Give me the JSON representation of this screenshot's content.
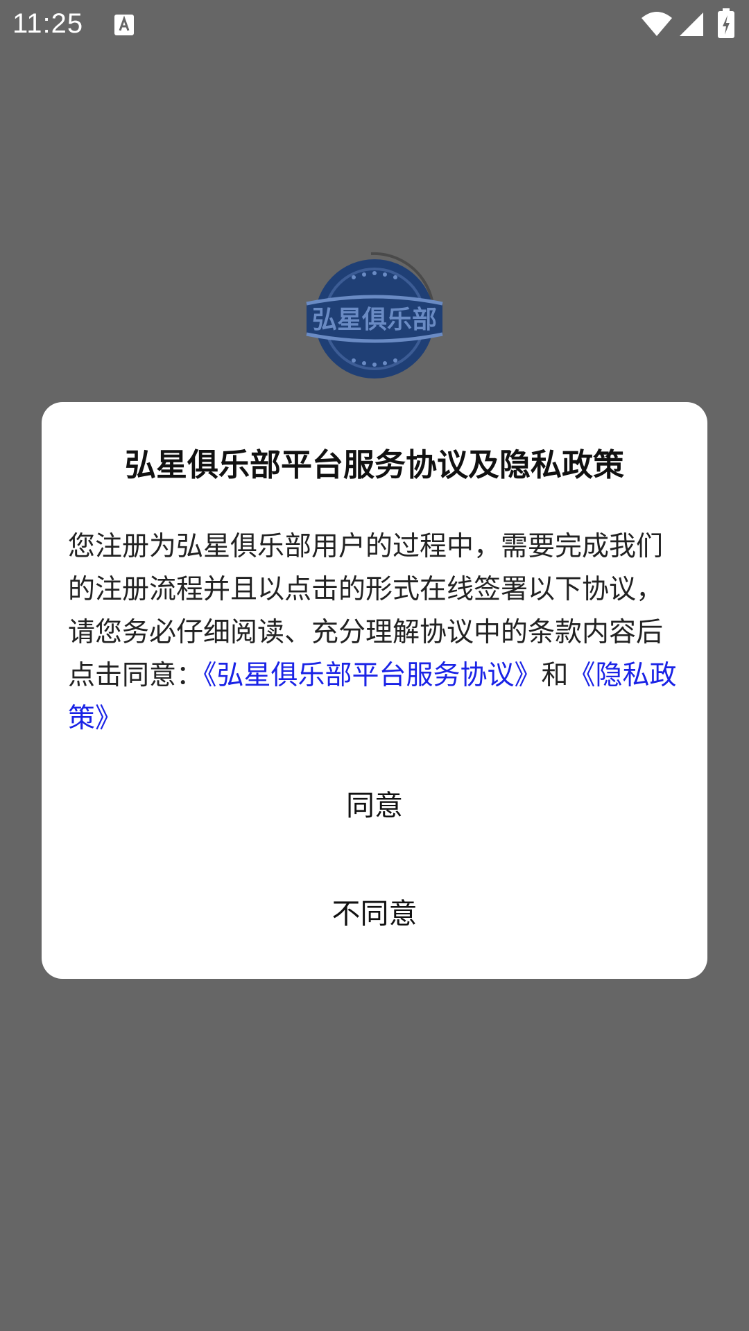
{
  "status_bar": {
    "time": "11:25",
    "icons": [
      "text-a-icon",
      "wifi-icon",
      "cellular-signal-icon",
      "battery-charging-icon"
    ]
  },
  "logo": {
    "text": "弘星俱乐部",
    "icon": "club-logo-icon",
    "colors": {
      "primary": "#1f3f75",
      "accent": "#6a8bc4"
    }
  },
  "dialog": {
    "title": "弘星俱乐部平台服务协议及隐私政策",
    "body_text": "您注册为弘星俱乐部用户的过程中，需要完成我们的注册流程并且以点击的形式在线签署以下协议， 请您务必仔细阅读、充分理解协议中的条款内容后点击同意：",
    "service_link": "《弘星俱乐部平台服务协议》",
    "conjunction": "和",
    "privacy_link": "《隐私政策》",
    "agree_button": "同意",
    "disagree_button": "不同意"
  },
  "colors": {
    "overlay_background": "#666666",
    "link": "#1a23e6",
    "dialog_background": "#ffffff"
  }
}
